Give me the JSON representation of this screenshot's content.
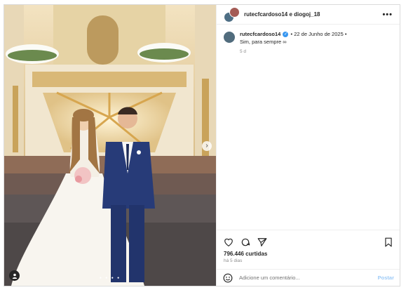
{
  "post": {
    "authors": "rutecfcardoso14 e diogoj_18",
    "more_label": "•••"
  },
  "caption": {
    "username": "rutecfcardoso14",
    "date_text": "• 22 de Junho de 2025 •",
    "text": "Sim, para sempre ∞",
    "age": "5 d"
  },
  "stats": {
    "likes": "796.446 curtidas",
    "posted": "há 5 dias"
  },
  "comment": {
    "placeholder": "Adicione um comentário...",
    "post_label": "Postar"
  },
  "media": {
    "next_label": "›",
    "dots": "● ● ● ●"
  },
  "colors": {
    "verified": "#3897f0",
    "post_button": "#9ecbf7"
  }
}
